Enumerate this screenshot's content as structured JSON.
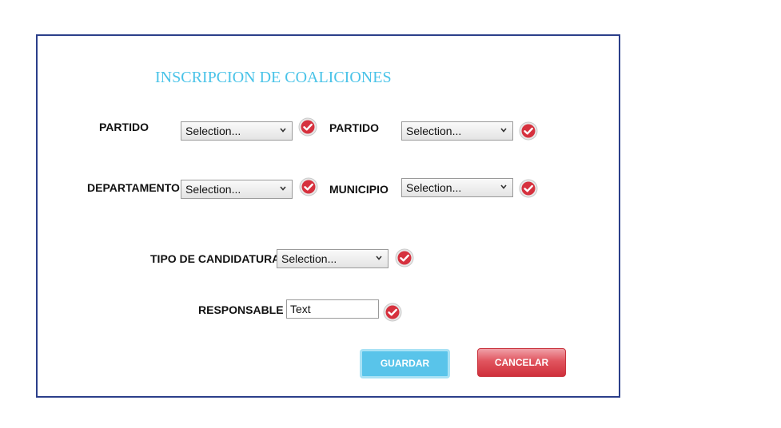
{
  "form": {
    "title": "INSCRIPCION DE COALICIONES",
    "fields": {
      "partido_1": {
        "label": "PARTIDO",
        "value": "Selection..."
      },
      "partido_2": {
        "label": "PARTIDO",
        "value": "Selection..."
      },
      "departamento": {
        "label": "DEPARTAMENTO",
        "value": "Selection..."
      },
      "municipio": {
        "label": "MUNICIPIO",
        "value": "Selection..."
      },
      "tipo_candidatura": {
        "label": "TIPO DE CANDIDATURA",
        "value": "Selection..."
      },
      "responsable": {
        "label": "RESPONSABLE",
        "value": "Text"
      }
    },
    "buttons": {
      "save": "GUARDAR",
      "cancel": "CANCELAR"
    },
    "icons": {
      "chevron": "chevron-down-icon",
      "valid": "check-circle-icon"
    },
    "colors": {
      "title": "#49c3e8",
      "border": "#2b3f8a",
      "save": "#59c4ea",
      "cancel": "#d8404b",
      "check": "#d6313e"
    }
  }
}
